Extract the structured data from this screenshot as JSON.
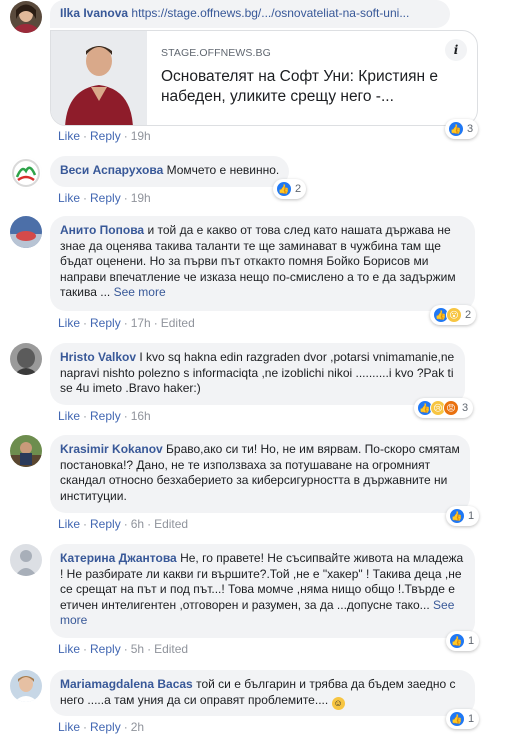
{
  "comments": [
    {
      "author": "Ilka Ivanova",
      "text": "https://stage.offnews.bg/.../osnovateliat-na-soft-uni...",
      "preview": {
        "site": "STAGE.OFFNEWS.BG",
        "title": "Основателят на Софт Уни: Кристиян е набеден, уликите срещу него -..."
      },
      "like": "Like",
      "reply": "Reply",
      "time": "19h",
      "reactions_count": "3"
    },
    {
      "author": "Веси Аспарухова",
      "text": "Момчето е невинно.",
      "like": "Like",
      "reply": "Reply",
      "time": "19h",
      "reactions_count": "2"
    },
    {
      "author": "Анито Попова",
      "text": "и той да е какво от това след като нашата държава не знае да оценява такива таланти те ще заминават в чужбина там ще бъдат оценени. Но за първи път откакто помня Бойко Борисов ми направи впечатление че изказа нещо по-смислено а то е да задържим такива ...",
      "see_more": "See more",
      "like": "Like",
      "reply": "Reply",
      "time": "17h",
      "edited": "Edited",
      "reactions_count": "2"
    },
    {
      "author": "Hristo Valkov",
      "text": "I kvo sq hakna edin razgraden dvor ,potarsi vnimamanie,ne napravi nishto polezno s informaciqta ,ne izoblichi nikoi ..........i kvo ?Pak ti se 4u imeto .Bravo haker:)",
      "like": "Like",
      "reply": "Reply",
      "time": "16h",
      "reactions_count": "3"
    },
    {
      "author": "Krasimir Kokanov",
      "text": "Браво,ако си ти! Но, не им вярвам. По-скоро смятам постановка!? Дано, не те използваха за потушаване на огромният скандал относно безхаберието за киберсигурността в държавните ни институции.",
      "like": "Like",
      "reply": "Reply",
      "time": "6h",
      "edited": "Edited",
      "reactions_count": "1"
    },
    {
      "author": "Катерина Джантова",
      "text": "Не, го правете! Не съсипвайте живота на младежа ! Не разбирате ли какви ги вършите?.Той ,не е \"хакер\" ! Такива деца ,не се срещат на път и под път...! Това момче ,няма нищо общо !.Твърде е етичен интелигентен ,отговорен и разумен, за да ...допусне тако...",
      "see_more": "See more",
      "like": "Like",
      "reply": "Reply",
      "time": "5h",
      "edited": "Edited",
      "reactions_count": "1"
    },
    {
      "author": "Mariamagdalena Bacas",
      "text": "той си е българин и трябва да бъдем заедно с него .....а там уния да си оправят проблемите....",
      "like": "Like",
      "reply": "Reply",
      "time": "2h",
      "reactions_count": "1"
    }
  ],
  "colors": {
    "author": "#385898",
    "bubble": "#f2f3f5",
    "like_blue": "#2078f4"
  }
}
